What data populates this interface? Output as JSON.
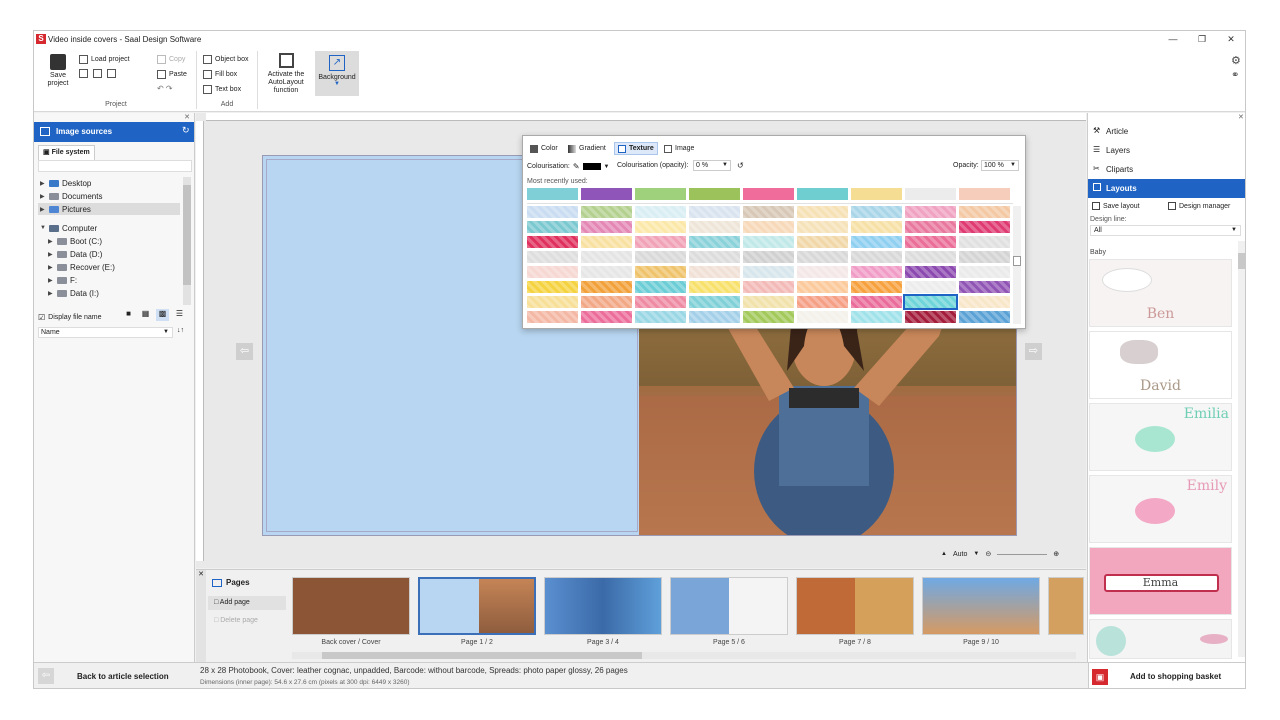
{
  "window": {
    "title": "Video inside covers - Saal Design Software",
    "logo": "S"
  },
  "ribbon": {
    "project": {
      "save": "Save project",
      "load": "Load project",
      "copy": "Copy",
      "paste": "Paste",
      "group": "Project"
    },
    "add": {
      "object_box": "Object box",
      "fill_box": "Fill box",
      "text_box": "Text box",
      "group": "Add"
    },
    "autolayout": "Activate the AutoLayout function",
    "background": "Background"
  },
  "texture_popup": {
    "tabs": [
      "Color",
      "Gradient",
      "Texture",
      "Image"
    ],
    "active_tab": "Texture",
    "colourisation_label": "Colourisation:",
    "opacity_label": "Colourisation (opacity):",
    "opacity_value": "0 %",
    "opacity2_label": "Opacity:",
    "opacity2_value": "100 %",
    "recent_label": "Most recently used:",
    "recent_colors": [
      "#7fd0d6",
      "#8f55b9",
      "#9fd07c",
      "#9cc25c",
      "#f06c9a",
      "#6fcfd0",
      "#f5dd93",
      "#ececec",
      "#f6cdbb"
    ],
    "grid_colors": [
      [
        "#c9dcf1",
        "#b3d08e",
        "#d8eef3",
        "#d8e3ef",
        "#d7c7b6",
        "#f6e1b5",
        "#a8d6e8",
        "#f0a2c1",
        "#f3c8a3"
      ],
      [
        "#7bc9d0",
        "#e487b5",
        "#fbe8a8",
        "#eee5d8",
        "#f7d8b8",
        "#f6e2b8",
        "#f6e0a6",
        "#e8789e",
        "#df3b72"
      ],
      [
        "#e0305d",
        "#f8e1a0",
        "#f1a2b6",
        "#8ad2d9",
        "#c0e8e8",
        "#f1d7a8",
        "#8fcff0",
        "#eb6e98",
        "#e0e0e0"
      ],
      [
        "#dedede",
        "#e4e4e4",
        "#d9d9d9",
        "#dcdcdc",
        "#d0d0d0",
        "#d8d8d8",
        "#d8d8d8",
        "#dcdcdc",
        "#d4d4d4"
      ],
      [
        "#f6d7d2",
        "#e6e6e6",
        "#efc36b",
        "#f0e0d5",
        "#d7e6ec",
        "#f4e7e7",
        "#f19cc6",
        "#8c4ab0",
        "#eaeaea"
      ],
      [
        "#f5d23f",
        "#f2a13a",
        "#6bcdd5",
        "#f7e16b",
        "#f2b9b7",
        "#fbc99a",
        "#f6a13e",
        "#ececec",
        "#9054b5"
      ],
      [
        "#f7df97",
        "#f2a885",
        "#ef8aa3",
        "#7fd0d7",
        "#f1e1aa",
        "#f59f85",
        "#ea6c9a",
        "#6dd4d9",
        "#f8e6c8"
      ],
      [
        "#f3b7a4",
        "#ec6c9a",
        "#9ad7e4",
        "#a3d0e8",
        "#a2c95a",
        "#f3f1ea",
        "#9fe2ea",
        "#a41e3c",
        "#5aa2d6"
      ]
    ]
  },
  "left_panel": {
    "header": "Image sources",
    "tab": "File system",
    "tree": [
      "Desktop",
      "Documents",
      "Pictures",
      "Computer",
      "Boot (C:)",
      "Data (D:)",
      "Recover (E:)",
      "F:",
      "Data (I:)"
    ],
    "display_file_name": "Display file name",
    "sort": "Name",
    "back_button": "Back to article selection"
  },
  "right_panel": {
    "items": [
      "Article",
      "Layers",
      "Cliparts",
      "Layouts"
    ],
    "active": "Layouts",
    "save_layout": "Save layout",
    "design_manager": "Design manager",
    "design_line_label": "Design line:",
    "design_line_value": "All",
    "category": "Baby",
    "layouts": [
      "Ben",
      "David",
      "Emilia",
      "Emily",
      "Emma"
    ],
    "basket_button": "Add to shopping basket"
  },
  "canvas": {
    "zoom": "Auto",
    "prev_icon": "arrow-left-icon",
    "next_icon": "arrow-right-icon"
  },
  "pages": {
    "title": "Pages",
    "add": "Add page",
    "delete": "Delete page",
    "thumbs": [
      "Back cover / Cover",
      "Page 1 / 2",
      "Page 3 / 4",
      "Page 5 / 6",
      "Page 7 / 8",
      "Page 9 / 10"
    ]
  },
  "status": {
    "line1": "28 x 28 Photobook, Cover: leather cognac, unpadded, Barcode: without barcode, Spreads: photo paper glossy, 26 pages",
    "line2": "Dimensions (inner page): 54.6 x 27.6 cm (pixels at 300 dpi: 6449 x 3260)"
  },
  "colors": {
    "accent": "#1f64c4",
    "brand": "#d6282f",
    "popup_bg": "#ffffff"
  }
}
